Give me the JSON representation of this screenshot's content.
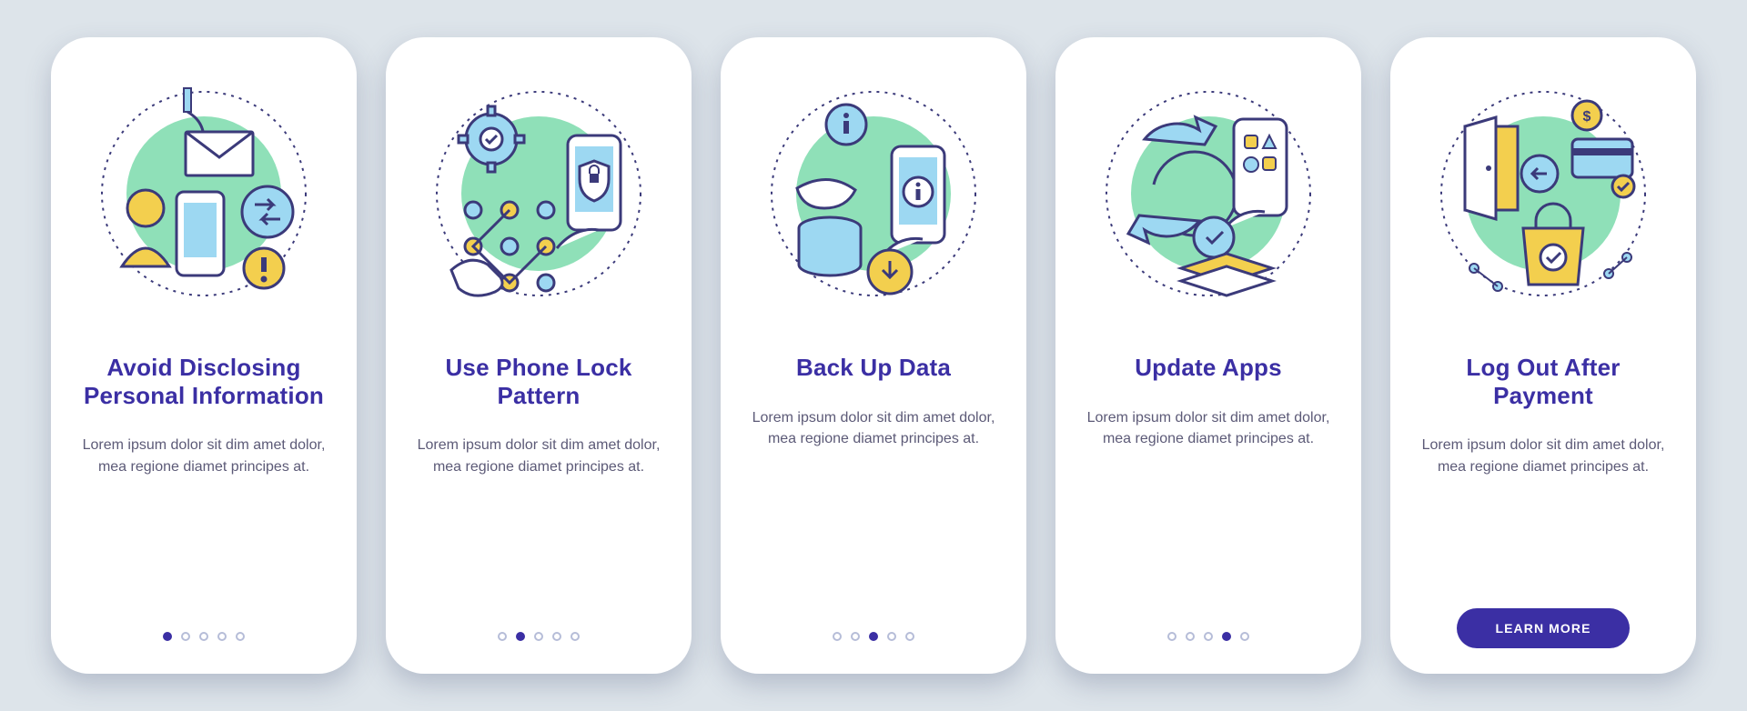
{
  "colors": {
    "background": "#dde4ea",
    "card": "#ffffff",
    "primary": "#3b2fa4",
    "text": "#5c5a77",
    "accent_green": "#8fe0b8",
    "accent_blue": "#9dd8f2",
    "accent_yellow": "#f3cf4e",
    "stroke": "#3b3a7a"
  },
  "screens": [
    {
      "title": "Avoid Disclosing Personal Information",
      "desc": "Lorem ipsum dolor sit dim amet dolor, mea regione diamet principes at.",
      "icon": "avoid-disclose-icon",
      "pager": {
        "total": 5,
        "active": 0
      }
    },
    {
      "title": "Use Phone Lock Pattern",
      "desc": "Lorem ipsum dolor sit dim amet dolor, mea regione diamet principes at.",
      "icon": "lock-pattern-icon",
      "pager": {
        "total": 5,
        "active": 1
      }
    },
    {
      "title": "Back Up Data",
      "desc": "Lorem ipsum dolor sit dim amet dolor, mea regione diamet principes at.",
      "icon": "backup-data-icon",
      "pager": {
        "total": 5,
        "active": 2
      }
    },
    {
      "title": "Update Apps",
      "desc": "Lorem ipsum dolor sit dim amet dolor, mea regione diamet principes at.",
      "icon": "update-apps-icon",
      "pager": {
        "total": 5,
        "active": 3
      }
    },
    {
      "title": "Log Out After Payment",
      "desc": "Lorem ipsum dolor sit dim amet dolor, mea regione diamet principes at.",
      "icon": "logout-payment-icon",
      "cta_label": "LEARN MORE"
    }
  ]
}
